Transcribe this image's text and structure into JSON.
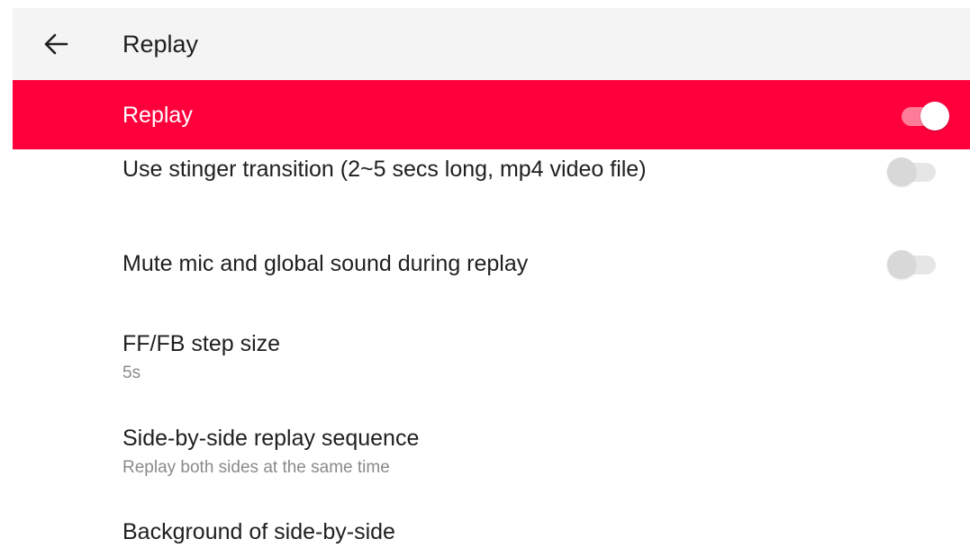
{
  "header": {
    "back_icon": "arrow-left-icon",
    "title": "Replay"
  },
  "master_switch": {
    "label": "Replay",
    "enabled": true,
    "accent_color": "#ff003c"
  },
  "settings": {
    "stinger": {
      "title": "Use stinger transition (2~5 secs long, mp4 video file)",
      "enabled": false
    },
    "mute": {
      "title": "Mute mic and global sound during replay",
      "enabled": false
    },
    "step_size": {
      "title": "FF/FB step size",
      "value": "5s"
    },
    "sbs_sequence": {
      "title": "Side-by-side replay sequence",
      "value": "Replay both sides at the same time"
    },
    "sbs_background": {
      "title": "Background of side-by-side"
    }
  }
}
